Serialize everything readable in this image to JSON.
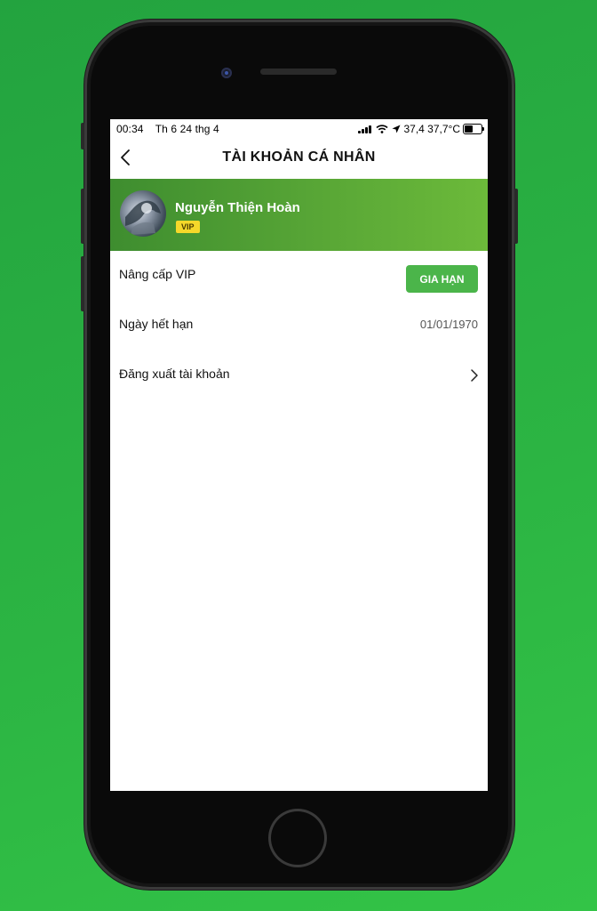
{
  "status_bar": {
    "time": "00:34",
    "date": "Th 6 24 thg 4",
    "indicators": "37,4 37,7°C"
  },
  "header": {
    "title": "TÀI KHOẢN CÁ NHÂN"
  },
  "profile": {
    "name": "Nguyễn Thiện Hoàn",
    "badge": "VIP"
  },
  "menu": {
    "upgrade": {
      "label": "Nâng cấp VIP",
      "button": "GIA HẠN"
    },
    "expiry": {
      "label": "Ngày hết hạn",
      "value": "01/01/1970"
    },
    "logout": {
      "label": "Đăng xuất tài khoản"
    }
  },
  "colors": {
    "brand_green": "#4bb54a",
    "vip_yellow": "#f5d82a",
    "background": "#2cb543"
  },
  "icons": [
    "back-icon",
    "signal-icon",
    "wifi-icon",
    "location-arrow-icon",
    "battery-icon",
    "chevron-right-icon"
  ]
}
